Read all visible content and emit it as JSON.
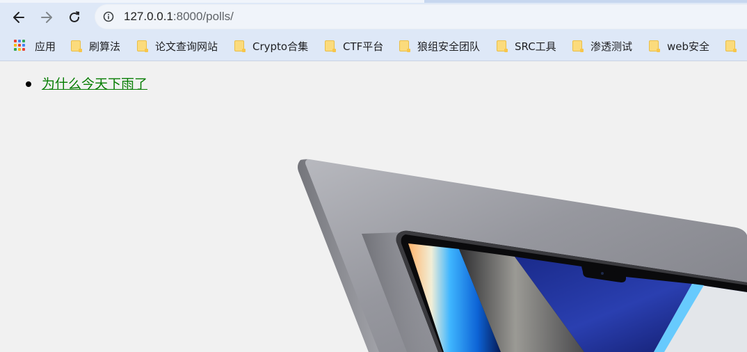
{
  "browser": {
    "url": {
      "host": "127.0.0.1",
      "rest": ":8000/polls/"
    },
    "icons": {
      "back": "back-arrow-icon",
      "forward": "forward-arrow-icon",
      "reload": "reload-icon",
      "info": "info-icon"
    }
  },
  "bookmarks": [
    {
      "label": "应用",
      "icon": "apps-grid-icon"
    },
    {
      "label": "刷算法",
      "icon": "folder-icon"
    },
    {
      "label": "论文查询网站",
      "icon": "folder-icon"
    },
    {
      "label": "Crypto合集",
      "icon": "folder-icon"
    },
    {
      "label": "CTF平台",
      "icon": "folder-icon"
    },
    {
      "label": "狼组安全团队",
      "icon": "folder-icon"
    },
    {
      "label": "SRC工具",
      "icon": "folder-icon"
    },
    {
      "label": "渗透测试",
      "icon": "folder-icon"
    },
    {
      "label": "web安全",
      "icon": "folder-icon"
    },
    {
      "label": "",
      "icon": "folder-icon"
    }
  ],
  "page": {
    "polls": [
      {
        "question": "为什么今天下雨了"
      }
    ],
    "link_color": "#047c00",
    "background_color": "#f1f1f1"
  },
  "colors": {
    "toolbar": "#dee8f7",
    "omnibox": "#f0f4fa",
    "folder": "#fbdb7c"
  }
}
